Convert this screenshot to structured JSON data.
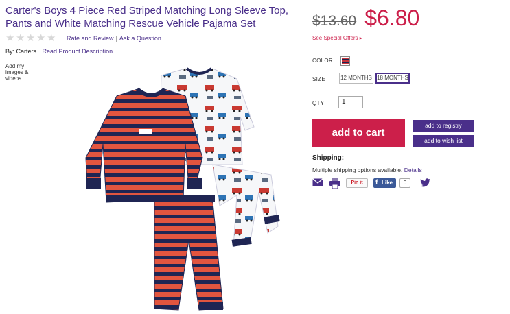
{
  "product": {
    "title": "Carter's Boys 4 Piece Red Striped Matching Long Sleeve Top, Pants and White Matching Rescue Vehicle Pajama Set",
    "rating_stars": 5,
    "rating_value": 0,
    "rate_review_label": "Rate and Review",
    "separator": "|",
    "ask_question_label": "Ask a Question",
    "by_label": "By: Carters",
    "read_description_label": "Read Product Description",
    "add_media_label": "Add my images & videos"
  },
  "pricing": {
    "old_price": "$13.60",
    "new_price": "$6.80",
    "special_offers_label": "See Special Offers ▸"
  },
  "options": {
    "color_label": "COLOR",
    "size_label": "SIZE",
    "sizes": [
      "12 MONTHS",
      "18 MONTHS"
    ],
    "selected_size": "18 MONTHS",
    "qty_label": "QTY",
    "qty_value": "1"
  },
  "actions": {
    "add_to_cart": "add to cart",
    "add_to_registry": "add to registry",
    "add_to_wish_list": "add to wish list"
  },
  "shipping": {
    "title": "Shipping:",
    "text": "Multiple shipping options available.",
    "details_label": "Details"
  },
  "social": {
    "pinit_label": "Pin it",
    "fb_like_label": "Like",
    "fb_count": "0",
    "icons": [
      "email-icon",
      "print-icon",
      "pinterest-icon",
      "facebook-icon",
      "twitter-icon"
    ]
  },
  "colors": {
    "brand_purple": "#4a2f8a",
    "sale_red": "#cc1f4a",
    "facebook_blue": "#3b5998"
  }
}
